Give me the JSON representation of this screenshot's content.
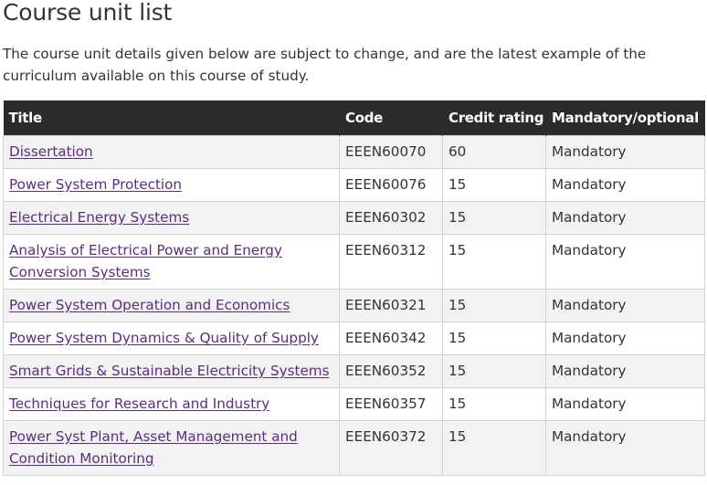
{
  "page": {
    "title": "Course unit list",
    "intro": "The course unit details given below are subject to change, and are the latest example of the curriculum available on this course of study."
  },
  "table": {
    "headers": {
      "title": "Title",
      "code": "Code",
      "credit": "Credit rating",
      "mandatory": "Mandatory/optional"
    },
    "rows": [
      {
        "title": "Dissertation",
        "code": "EEEN60070",
        "credit": "60",
        "mandatory": "Mandatory"
      },
      {
        "title": "Power System Protection",
        "code": "EEEN60076",
        "credit": "15",
        "mandatory": "Mandatory"
      },
      {
        "title": "Electrical Energy Systems",
        "code": "EEEN60302",
        "credit": "15",
        "mandatory": "Mandatory"
      },
      {
        "title": "Analysis of Electrical Power and Energy Conversion Systems",
        "code": "EEEN60312",
        "credit": "15",
        "mandatory": "Mandatory"
      },
      {
        "title": "Power System Operation and Economics",
        "code": "EEEN60321",
        "credit": "15",
        "mandatory": "Mandatory"
      },
      {
        "title": "Power System Dynamics & Quality of Supply",
        "code": "EEEN60342",
        "credit": "15",
        "mandatory": "Mandatory"
      },
      {
        "title": "Smart Grids & Sustainable Electricity Systems",
        "code": "EEEN60352",
        "credit": "15",
        "mandatory": "Mandatory"
      },
      {
        "title": "Techniques for Research and Industry",
        "code": "EEEN60357",
        "credit": "15",
        "mandatory": "Mandatory"
      },
      {
        "title": "Power Syst Plant, Asset Management and Condition Monitoring",
        "code": "EEEN60372",
        "credit": "15",
        "mandatory": "Mandatory"
      }
    ]
  },
  "colors": {
    "header_bg": "#2b2b2b",
    "link": "#5a2d82",
    "row_stripe": "#f2f2f2",
    "border": "#d4d4d4"
  }
}
